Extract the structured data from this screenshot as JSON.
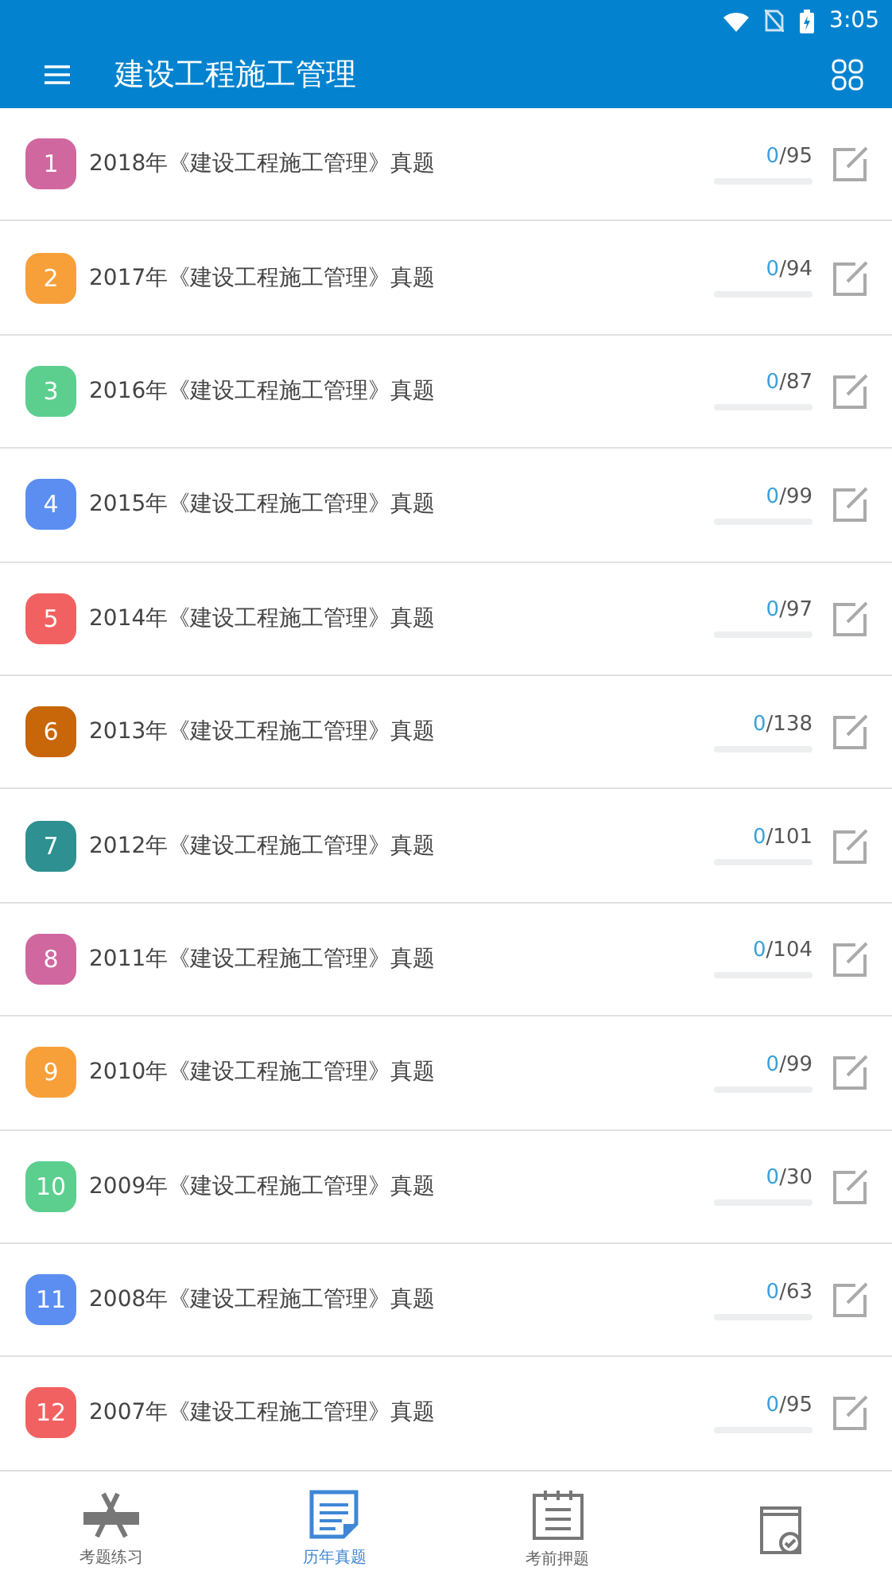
{
  "status_bar": {
    "time": "3:05"
  },
  "app_bar": {
    "title": "建设工程施工管理"
  },
  "papers": [
    {
      "number": "1",
      "title": "2018年《建设工程施工管理》真题",
      "done": "0",
      "total": "/95",
      "level": 0,
      "color": "#d0679f"
    },
    {
      "number": "2",
      "title": "2017年《建设工程施工管理》真题",
      "done": "0",
      "total": "/94",
      "level": 0,
      "color": "#f7a03a"
    },
    {
      "number": "3",
      "title": "2016年《建设工程施工管理》真题",
      "done": "0",
      "total": "/87",
      "level": 0,
      "color": "#5ccf8f"
    },
    {
      "number": "4",
      "title": "2015年《建设工程施工管理》真题",
      "done": "0",
      "total": "/99",
      "level": 0,
      "color": "#5b8ef0"
    },
    {
      "number": "5",
      "title": "2014年《建设工程施工管理》真题",
      "done": "0",
      "total": "/97",
      "level": 0,
      "color": "#f26161"
    },
    {
      "number": "6",
      "title": "2013年《建设工程施工管理》真题",
      "done": "0",
      "total": "/138",
      "level": 0,
      "color": "#c8660a"
    },
    {
      "number": "7",
      "title": "2012年《建设工程施工管理》真题",
      "done": "0",
      "total": "/101",
      "level": 0,
      "color": "#2e9090"
    },
    {
      "number": "8",
      "title": "2011年《建设工程施工管理》真题",
      "done": "0",
      "total": "/104",
      "level": 0,
      "color": "#d0679f"
    },
    {
      "number": "9",
      "title": "2010年《建设工程施工管理》真题",
      "done": "0",
      "total": "/99",
      "level": 0,
      "color": "#f7a03a"
    },
    {
      "number": "10",
      "title": "2009年《建设工程施工管理》真题",
      "done": "0",
      "total": "/30",
      "level": 0,
      "color": "#5ccf8f"
    },
    {
      "number": "11",
      "title": "2008年《建设工程施工管理》真题",
      "done": "0",
      "total": "/63",
      "level": 0,
      "color": "#5b8ef0"
    },
    {
      "number": "12",
      "title": "2007年《建设工程施工管理》真题",
      "done": "0",
      "total": "/95",
      "level": 0,
      "color": "#f26161"
    }
  ],
  "bottom_nav": [
    {
      "kind": "practice",
      "label": "考题练习",
      "selected": false
    },
    {
      "kind": "past",
      "label": "历年真题",
      "selected": true
    },
    {
      "kind": "predict",
      "label": "考前押题",
      "selected": false
    },
    {
      "kind": "book",
      "selected": false
    }
  ]
}
